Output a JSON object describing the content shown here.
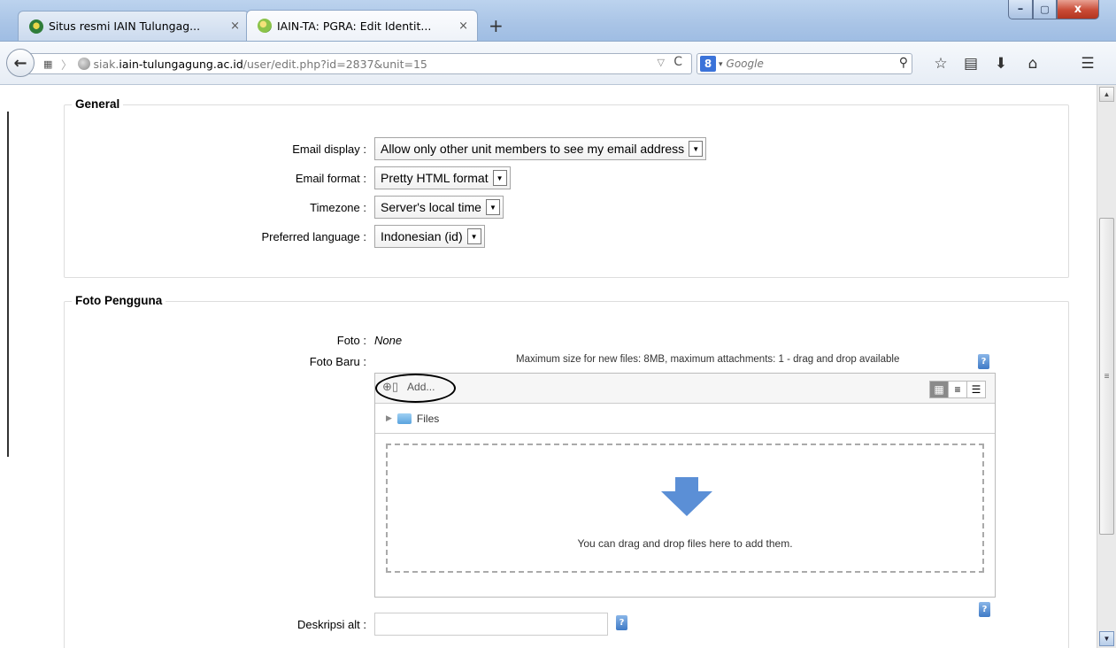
{
  "tabs": [
    {
      "title": "Situs resmi IAIN Tulungag...",
      "close": "×",
      "active": false
    },
    {
      "title": "IAIN-TA: PGRA: Edit Identit...",
      "close": "×",
      "active": true
    }
  ],
  "new_tab": "+",
  "window_buttons": {
    "minimize": "–",
    "maximize": "▢",
    "close": "x"
  },
  "nav": {
    "back": "←",
    "url_host_pre": "siak.",
    "url_host": "iain-tulungagung.ac.id",
    "url_path": "/user/edit.php?id=2837&unit=15",
    "url_dropdown": "▽",
    "reload": "C",
    "search_engine": "8",
    "search_placeholder": "Google"
  },
  "toolbar_icons": [
    "search-icon",
    "star-icon",
    "reading-list-icon",
    "download-icon",
    "home-icon",
    "menu-icon"
  ],
  "general": {
    "legend": "General",
    "fields": [
      {
        "label": "Email display :",
        "value": "Allow only other unit members to see my email address"
      },
      {
        "label": "Email format :",
        "value": "Pretty HTML format"
      },
      {
        "label": "Timezone :",
        "value": "Server's local time"
      },
      {
        "label": "Preferred language :",
        "value": "Indonesian (id)"
      }
    ]
  },
  "foto": {
    "legend": "Foto Pengguna",
    "foto_label": "Foto :",
    "foto_value": "None",
    "foto_baru_label": "Foto Baru :",
    "fm_info": "Maximum size for new files: 8MB, maximum attachments: 1 - drag and drop available",
    "add_label": "Add...",
    "folder_name": "Files",
    "drop_text": "You can drag and drop files here to add them.",
    "alt_label": "Deskripsi alt :",
    "help": "?"
  },
  "colors": {
    "drop_arrow": "#5b8fd6",
    "help_icon": "#3f7ac6"
  }
}
